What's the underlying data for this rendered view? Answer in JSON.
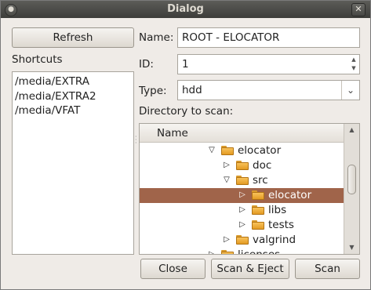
{
  "window": {
    "title": "Dialog"
  },
  "left": {
    "refresh_label": "Refresh",
    "shortcuts_label": "Shortcuts",
    "shortcuts": [
      "/media/EXTRA",
      "/media/EXTRA2",
      "/media/VFAT"
    ]
  },
  "form": {
    "name_label": "Name:",
    "name_value": "ROOT - ELOCATOR",
    "id_label": "ID:",
    "id_value": "1",
    "type_label": "Type:",
    "type_value": "hdd",
    "dir_label": "Directory to scan:"
  },
  "tree": {
    "column_header": "Name",
    "rows": [
      {
        "name": "elocator",
        "expanded": true,
        "selected": false
      },
      {
        "name": "doc",
        "expanded": false,
        "selected": false
      },
      {
        "name": "src",
        "expanded": true,
        "selected": false
      },
      {
        "name": "elocator",
        "expanded": false,
        "selected": true
      },
      {
        "name": "libs",
        "expanded": false,
        "selected": false
      },
      {
        "name": "tests",
        "expanded": false,
        "selected": false
      },
      {
        "name": "valgrind",
        "expanded": false,
        "selected": false
      },
      {
        "name": "licenses",
        "expanded": false,
        "selected": false
      }
    ],
    "selection_color": "#a0644a"
  },
  "buttons": {
    "close": "Close",
    "scan_eject": "Scan & Eject",
    "scan": "Scan"
  }
}
